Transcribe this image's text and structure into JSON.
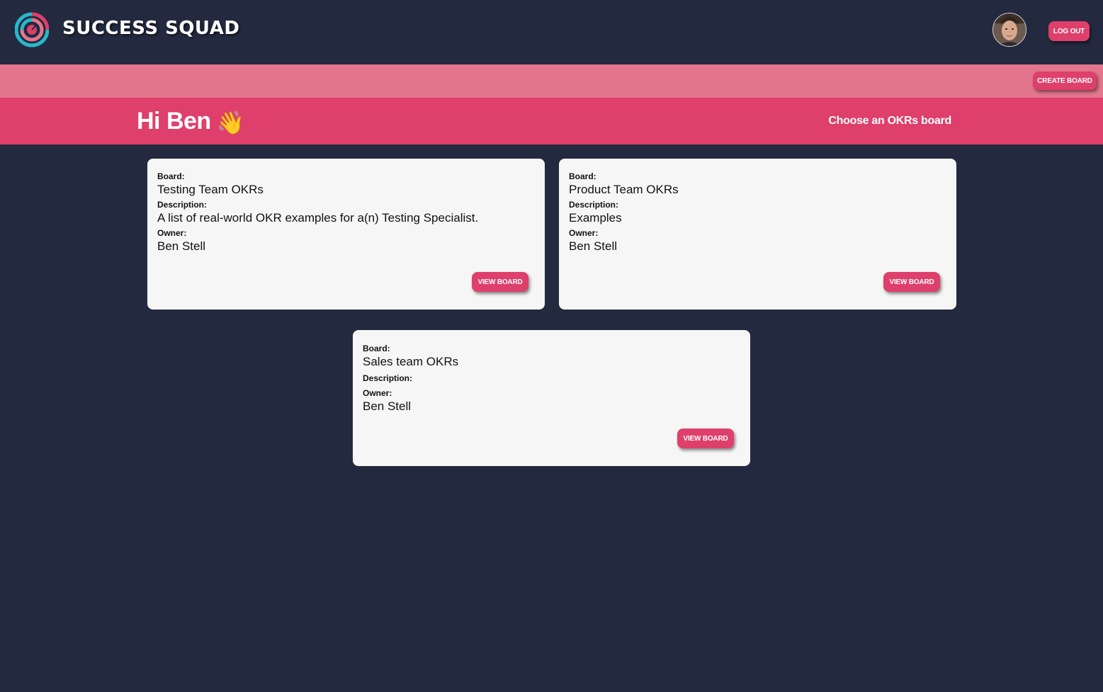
{
  "header": {
    "brand": "SUCCESS SQUAD",
    "logout_label": "LOG OUT",
    "avatar_icon": "user-avatar-photo"
  },
  "toolbar": {
    "create_label": "CREATE BOARD"
  },
  "hero": {
    "greeting": "Hi Ben",
    "wave": "👋",
    "subtitle": "Choose an OKRs board"
  },
  "labels": {
    "board": "Board:",
    "description": "Description:",
    "owner": "Owner:",
    "view": "VIEW BOARD"
  },
  "boards": [
    {
      "name": "Testing Team OKRs",
      "description": "A list of real-world OKR examples for a(n) Testing Specialist.",
      "owner": "Ben Stell"
    },
    {
      "name": "Product Team OKRs",
      "description": "Examples",
      "owner": "Ben Stell"
    },
    {
      "name": "Sales team OKRs",
      "description": "",
      "owner": "Ben Stell"
    }
  ],
  "colors": {
    "background": "#232a40",
    "accent": "#de3f6b",
    "accent_light": "#e3768c",
    "card": "#f6f6f6"
  }
}
